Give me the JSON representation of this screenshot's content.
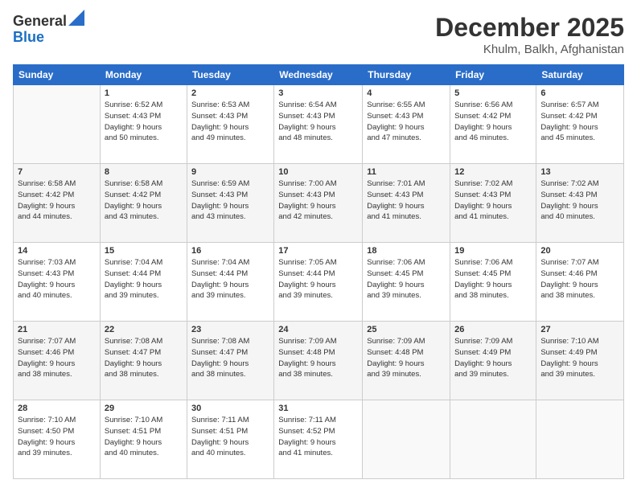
{
  "header": {
    "logo_line1": "General",
    "logo_line2": "Blue",
    "title": "December 2025",
    "subtitle": "Khulm, Balkh, Afghanistan"
  },
  "calendar": {
    "headers": [
      "Sunday",
      "Monday",
      "Tuesday",
      "Wednesday",
      "Thursday",
      "Friday",
      "Saturday"
    ],
    "rows": [
      [
        {
          "num": "",
          "info": ""
        },
        {
          "num": "1",
          "info": "Sunrise: 6:52 AM\nSunset: 4:43 PM\nDaylight: 9 hours\nand 50 minutes."
        },
        {
          "num": "2",
          "info": "Sunrise: 6:53 AM\nSunset: 4:43 PM\nDaylight: 9 hours\nand 49 minutes."
        },
        {
          "num": "3",
          "info": "Sunrise: 6:54 AM\nSunset: 4:43 PM\nDaylight: 9 hours\nand 48 minutes."
        },
        {
          "num": "4",
          "info": "Sunrise: 6:55 AM\nSunset: 4:43 PM\nDaylight: 9 hours\nand 47 minutes."
        },
        {
          "num": "5",
          "info": "Sunrise: 6:56 AM\nSunset: 4:42 PM\nDaylight: 9 hours\nand 46 minutes."
        },
        {
          "num": "6",
          "info": "Sunrise: 6:57 AM\nSunset: 4:42 PM\nDaylight: 9 hours\nand 45 minutes."
        }
      ],
      [
        {
          "num": "7",
          "info": "Sunrise: 6:58 AM\nSunset: 4:42 PM\nDaylight: 9 hours\nand 44 minutes."
        },
        {
          "num": "8",
          "info": "Sunrise: 6:58 AM\nSunset: 4:42 PM\nDaylight: 9 hours\nand 43 minutes."
        },
        {
          "num": "9",
          "info": "Sunrise: 6:59 AM\nSunset: 4:43 PM\nDaylight: 9 hours\nand 43 minutes."
        },
        {
          "num": "10",
          "info": "Sunrise: 7:00 AM\nSunset: 4:43 PM\nDaylight: 9 hours\nand 42 minutes."
        },
        {
          "num": "11",
          "info": "Sunrise: 7:01 AM\nSunset: 4:43 PM\nDaylight: 9 hours\nand 41 minutes."
        },
        {
          "num": "12",
          "info": "Sunrise: 7:02 AM\nSunset: 4:43 PM\nDaylight: 9 hours\nand 41 minutes."
        },
        {
          "num": "13",
          "info": "Sunrise: 7:02 AM\nSunset: 4:43 PM\nDaylight: 9 hours\nand 40 minutes."
        }
      ],
      [
        {
          "num": "14",
          "info": "Sunrise: 7:03 AM\nSunset: 4:43 PM\nDaylight: 9 hours\nand 40 minutes."
        },
        {
          "num": "15",
          "info": "Sunrise: 7:04 AM\nSunset: 4:44 PM\nDaylight: 9 hours\nand 39 minutes."
        },
        {
          "num": "16",
          "info": "Sunrise: 7:04 AM\nSunset: 4:44 PM\nDaylight: 9 hours\nand 39 minutes."
        },
        {
          "num": "17",
          "info": "Sunrise: 7:05 AM\nSunset: 4:44 PM\nDaylight: 9 hours\nand 39 minutes."
        },
        {
          "num": "18",
          "info": "Sunrise: 7:06 AM\nSunset: 4:45 PM\nDaylight: 9 hours\nand 39 minutes."
        },
        {
          "num": "19",
          "info": "Sunrise: 7:06 AM\nSunset: 4:45 PM\nDaylight: 9 hours\nand 38 minutes."
        },
        {
          "num": "20",
          "info": "Sunrise: 7:07 AM\nSunset: 4:46 PM\nDaylight: 9 hours\nand 38 minutes."
        }
      ],
      [
        {
          "num": "21",
          "info": "Sunrise: 7:07 AM\nSunset: 4:46 PM\nDaylight: 9 hours\nand 38 minutes."
        },
        {
          "num": "22",
          "info": "Sunrise: 7:08 AM\nSunset: 4:47 PM\nDaylight: 9 hours\nand 38 minutes."
        },
        {
          "num": "23",
          "info": "Sunrise: 7:08 AM\nSunset: 4:47 PM\nDaylight: 9 hours\nand 38 minutes."
        },
        {
          "num": "24",
          "info": "Sunrise: 7:09 AM\nSunset: 4:48 PM\nDaylight: 9 hours\nand 38 minutes."
        },
        {
          "num": "25",
          "info": "Sunrise: 7:09 AM\nSunset: 4:48 PM\nDaylight: 9 hours\nand 39 minutes."
        },
        {
          "num": "26",
          "info": "Sunrise: 7:09 AM\nSunset: 4:49 PM\nDaylight: 9 hours\nand 39 minutes."
        },
        {
          "num": "27",
          "info": "Sunrise: 7:10 AM\nSunset: 4:49 PM\nDaylight: 9 hours\nand 39 minutes."
        }
      ],
      [
        {
          "num": "28",
          "info": "Sunrise: 7:10 AM\nSunset: 4:50 PM\nDaylight: 9 hours\nand 39 minutes."
        },
        {
          "num": "29",
          "info": "Sunrise: 7:10 AM\nSunset: 4:51 PM\nDaylight: 9 hours\nand 40 minutes."
        },
        {
          "num": "30",
          "info": "Sunrise: 7:11 AM\nSunset: 4:51 PM\nDaylight: 9 hours\nand 40 minutes."
        },
        {
          "num": "31",
          "info": "Sunrise: 7:11 AM\nSunset: 4:52 PM\nDaylight: 9 hours\nand 41 minutes."
        },
        {
          "num": "",
          "info": ""
        },
        {
          "num": "",
          "info": ""
        },
        {
          "num": "",
          "info": ""
        }
      ]
    ]
  }
}
